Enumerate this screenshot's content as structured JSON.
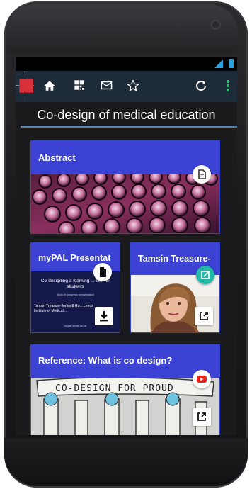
{
  "page": {
    "title": "Co-design of medical education"
  },
  "toolbar": {
    "icons": [
      "home-icon",
      "grid-icon",
      "mail-icon",
      "star-icon",
      "refresh-icon",
      "more-vert-icon"
    ],
    "accent": "#2ecc71"
  },
  "cards": {
    "abstract": {
      "title": "Abstract",
      "badge_icon": "document-icon"
    },
    "mypal": {
      "title": "myPAL Presentat",
      "badge_icon": "file-icon",
      "slide_title": "Co-designing a learning ... tool for students",
      "slide_sub": "Work in progress presentation",
      "slide_authors": "Tamsin Treasure-Jones & Ro... Leeds Institute of Medical...",
      "slide_footer": "mypal.leeds.ac.uk",
      "action_icon": "download-icon"
    },
    "tamsin": {
      "title": "Tamsin Treasure-",
      "badge_icon": "edit-icon",
      "action_icon": "external-link-icon"
    },
    "reference": {
      "title": "Reference: What is co design?",
      "badge_icon": "youtube-icon",
      "sign_text": "CO-DESIGN FOR PROUD",
      "action_icon": "external-link-icon"
    }
  },
  "colors": {
    "card_header": "#3b42d4",
    "toolbar_bg": "#1e2b38",
    "youtube_red": "#e62117",
    "teal": "#1fb9a8"
  }
}
